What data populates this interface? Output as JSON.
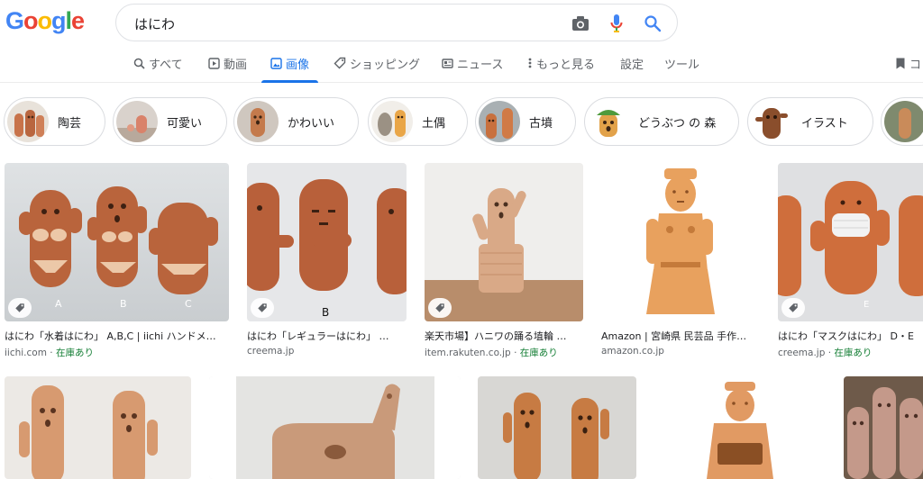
{
  "logo": {
    "letters": [
      "G",
      "o",
      "o",
      "g",
      "l",
      "e"
    ],
    "colors": [
      "#4285f4",
      "#ea4335",
      "#fbbc05",
      "#4285f4",
      "#34a853",
      "#ea4335"
    ]
  },
  "search": {
    "query": "はにわ"
  },
  "tabs": [
    {
      "label": "すべて",
      "icon": "search-icon"
    },
    {
      "label": "動画",
      "icon": "video-icon"
    },
    {
      "label": "画像",
      "icon": "image-icon",
      "active": true
    },
    {
      "label": "ショッピング",
      "icon": "tag-icon"
    },
    {
      "label": "ニュース",
      "icon": "news-icon"
    },
    {
      "label": "もっと見る",
      "icon": "more-vert-icon"
    },
    {
      "label": "設定"
    },
    {
      "label": "ツール"
    }
  ],
  "collections_label": "コ",
  "chips": [
    {
      "label": "陶芸"
    },
    {
      "label": "可愛い"
    },
    {
      "label": "かわいい"
    },
    {
      "label": "土偶"
    },
    {
      "label": "古墳"
    },
    {
      "label": "どうぶつ の 森"
    },
    {
      "label": "イラスト"
    },
    {
      "label": ""
    }
  ],
  "results": [
    {
      "title": "はにわ「水着はにわ」 A,B,C | iichi ハンドメ…",
      "source": "iichi.com",
      "stock": "在庫あり",
      "letters": [
        "A",
        "B",
        "C"
      ]
    },
    {
      "title": "はにわ「レギュラーはにわ」 …",
      "source": "creema.jp",
      "stock": "",
      "letters": [
        "B"
      ]
    },
    {
      "title": "楽天市場】ハニワの踊る埴輪 …",
      "source": "item.rakuten.co.jp",
      "stock": "在庫あり",
      "letters": []
    },
    {
      "title": "Amazon | 宮崎県 民芸品 手作…",
      "source": "amazon.co.jp",
      "stock": "",
      "letters": []
    },
    {
      "title": "はにわ「マスクはにわ」 D・E",
      "source": "creema.jp",
      "stock": "在庫あり",
      "letters": [
        "E"
      ]
    }
  ],
  "stock_separator": " · ",
  "colors": {
    "accent": "#1a73e8",
    "stock": "#188038",
    "terracotta": "#c8734a"
  }
}
